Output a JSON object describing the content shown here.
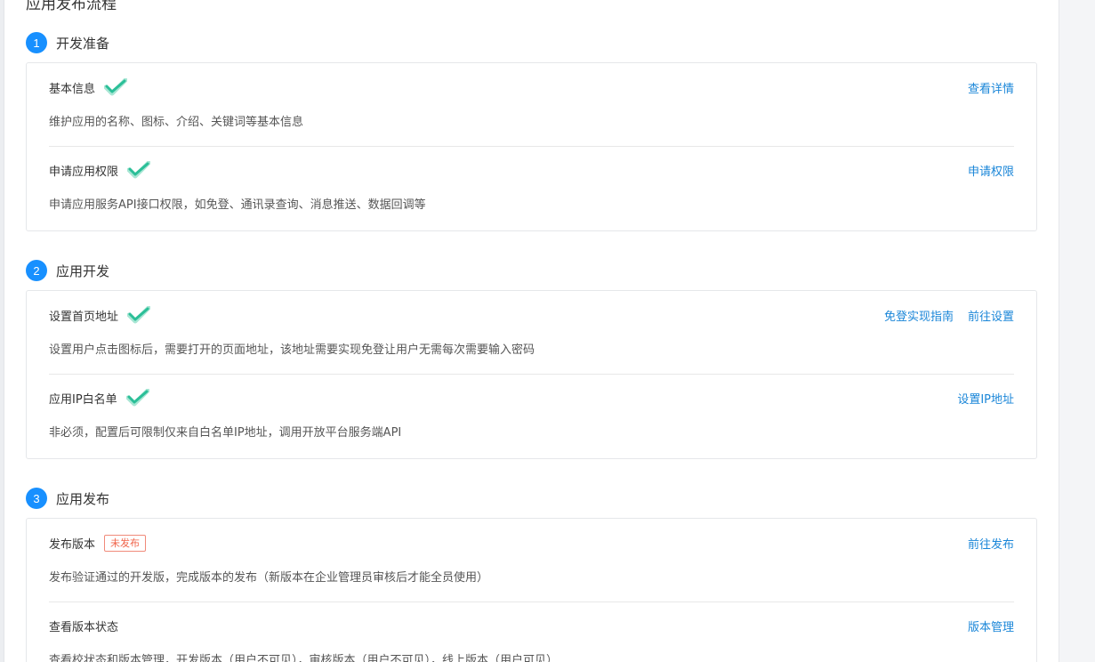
{
  "page": {
    "title": "应用发布流程"
  },
  "steps": [
    {
      "number": "1",
      "title": "开发准备",
      "items": [
        {
          "title": "基本信息",
          "status": "done",
          "description": "维护应用的名称、图标、介绍、关键词等基本信息",
          "links": [
            "查看详情"
          ]
        },
        {
          "title": "申请应用权限",
          "status": "done",
          "description": "申请应用服务API接口权限，如免登、通讯录查询、消息推送、数据回调等",
          "links": [
            "申请权限"
          ]
        }
      ]
    },
    {
      "number": "2",
      "title": "应用开发",
      "items": [
        {
          "title": "设置首页地址",
          "status": "done",
          "description": "设置用户点击图标后，需要打开的页面地址，该地址需要实现免登让用户无需每次需要输入密码",
          "links": [
            "免登实现指南",
            "前往设置"
          ]
        },
        {
          "title": "应用IP白名单",
          "status": "done",
          "description": "非必须，配置后可限制仅来自白名单IP地址，调用开放平台服务端API",
          "links": [
            "设置IP地址"
          ]
        }
      ]
    },
    {
      "number": "3",
      "title": "应用发布",
      "items": [
        {
          "title": "发布版本",
          "status": "badge",
          "badge": "未发布",
          "description": "发布验证通过的开发版，完成版本的发布（新版本在企业管理员审核后才能全员使用）",
          "links": [
            "前往发布"
          ]
        },
        {
          "title": "查看版本状态",
          "status": "none",
          "description": "查看校状态和版本管理，开发版本（用户不可见），审核版本（用户不可见），线上版本（用户可见）",
          "links": [
            "版本管理"
          ]
        }
      ]
    }
  ],
  "colors": {
    "accent": "#1890ff",
    "link": "#1a86d8",
    "check": "#2bbf98",
    "badge": "#f0644a"
  }
}
